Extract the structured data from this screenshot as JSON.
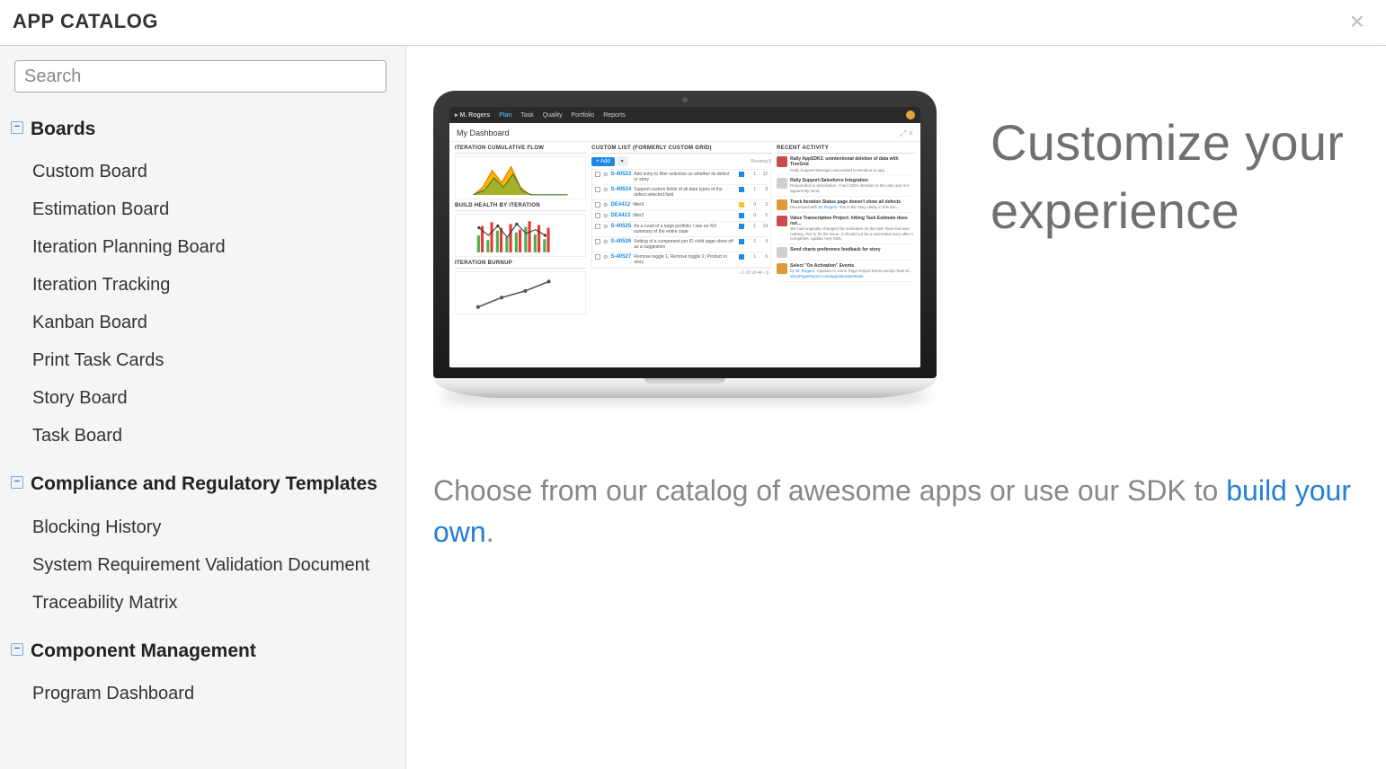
{
  "header": {
    "title": "APP CATALOG"
  },
  "search": {
    "placeholder": "Search",
    "value": ""
  },
  "categories": [
    {
      "name": "Boards",
      "expanded": true,
      "items": [
        "Custom Board",
        "Estimation Board",
        "Iteration Planning Board",
        "Iteration Tracking",
        "Kanban Board",
        "Print Task Cards",
        "Story Board",
        "Task Board"
      ]
    },
    {
      "name": "Compliance and Regulatory Templates",
      "expanded": true,
      "items": [
        "Blocking History",
        "System Requirement Validation Document",
        "Traceability Matrix"
      ]
    },
    {
      "name": "Component Management",
      "expanded": true,
      "items": [
        "Program Dashboard"
      ]
    }
  ],
  "content": {
    "hero_text": "Customize your experience",
    "sub_text_before": "Choose from our catalog of awesome apps or use our SDK to ",
    "sub_text_link": "build your own",
    "sub_text_after": ".",
    "preview": {
      "title": "My Dashboard",
      "nav": [
        "Plan",
        "Task",
        "Quality",
        "Portfolio",
        "Reports"
      ],
      "panels": {
        "left_titles": [
          "ITERATION CUMULATIVE FLOW",
          "BUILD HEALTH BY ITERATION",
          "ITERATION BURNUP"
        ],
        "mid_title": "CUSTOM LIST (FORMERLY CUSTOM GRID)",
        "right_title": "RECENT ACTIVITY"
      }
    }
  }
}
